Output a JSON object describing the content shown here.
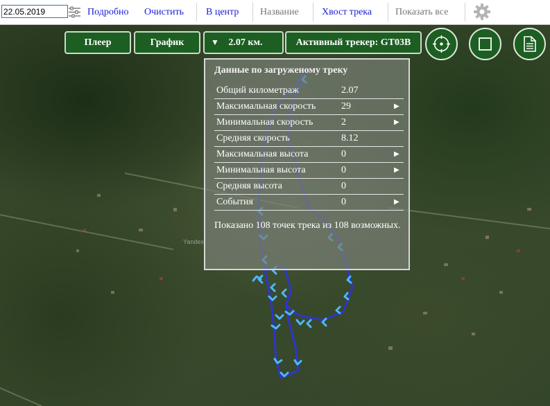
{
  "toolbar": {
    "date_value": "22.05.2019",
    "filter_icon": "sliders-icon",
    "details": "Подробно",
    "clear": "Очистить",
    "center": "В центр",
    "name": "Название",
    "track_tail": "Хвост трека",
    "show_all": "Показать все",
    "settings_icon": "gear-icon"
  },
  "map_buttons": {
    "player": "Плеер",
    "graph": "График",
    "distance_arrow": "▼",
    "distance": "2.07 км.",
    "active_tracker": "Активный трекер: GT03B",
    "locate_icon": "crosshair-icon",
    "square_icon": "square-icon",
    "report_icon": "document-icon"
  },
  "stats_panel": {
    "title": "Данные по загруженому треку",
    "rows": [
      {
        "label": "Общий километраж",
        "value": "2.07",
        "arrow": ""
      },
      {
        "label": "Максимальная скорость",
        "value": "29",
        "arrow": "▶"
      },
      {
        "label": "Минимальная скорость",
        "value": "2",
        "arrow": "▶"
      },
      {
        "label": "Средняя скорость",
        "value": "8.12",
        "arrow": ""
      },
      {
        "label": "Максимальная высота",
        "value": "0",
        "arrow": "▶"
      },
      {
        "label": "Минимальная высота",
        "value": "0",
        "arrow": "▶"
      },
      {
        "label": "Средняя высота",
        "value": "0",
        "arrow": ""
      },
      {
        "label": "События",
        "value": "0",
        "arrow": "▶"
      }
    ],
    "footer": "Показано 108 точек трека из 108 возможных."
  },
  "map_watermark": "Yandex",
  "colors": {
    "button_green": "#1d5e22",
    "link_blue": "#1a1ad8",
    "track_blue": "#2b36d9",
    "track_arrow": "#4db8ff"
  }
}
